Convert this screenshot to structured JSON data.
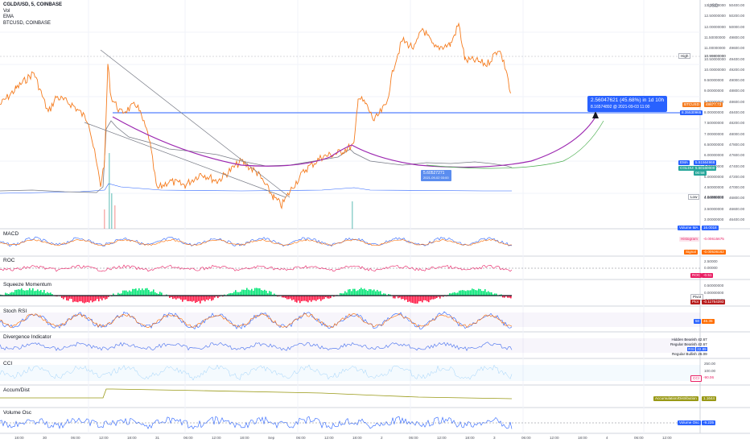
{
  "legend": {
    "symbol": "CGLD/USD, 5, COINBASE",
    "vol": "Vol",
    "ema": "EMA",
    "compare": "BTCUSD, COINBASE"
  },
  "currency": "USD",
  "panes": {
    "macd": "MACD",
    "roc": "ROC",
    "squeeze": "Squeeze Momentum",
    "stochrsi": "Stoch RSI",
    "divergence": "Divergence Indicator",
    "cci": "CCI",
    "accum": "Accum/Dist",
    "volosc": "Volume Osc"
  },
  "price_axis_left": [
    "13.00000000",
    "12.50000000",
    "12.00000000",
    "11.50000000",
    "11.00000000",
    "10.50000000",
    "10.00000000",
    "9.50000000",
    "9.00000000",
    "8.50000000",
    "8.00000000",
    "7.50000000",
    "7.00000000",
    "6.50000000",
    "6.00000000",
    "5.50000000",
    "5.00000000",
    "4.50000000",
    "4.00000000",
    "3.50000000",
    "3.00000000"
  ],
  "price_axis_right": [
    "50400.00",
    "50200.00",
    "50000.00",
    "49800.00",
    "49600.00",
    "49400.00",
    "49200.00",
    "49000.00",
    "48800.00",
    "48600.00",
    "48400.00",
    "48200.00",
    "48000.00",
    "47800.00",
    "47600.00",
    "47400.00",
    "47200.00",
    "47000.00",
    "46800.00",
    "46600.00",
    "46400.00"
  ],
  "tags": {
    "high_label": "High",
    "high_value": "10.99800000",
    "btcusd_label": "BTCUSD",
    "btcusd_value": "48677.73",
    "line_value": "8.35530965",
    "ema_label": "EMA",
    "ema_value": "5.51564968",
    "cgld_label": "CGLDUSD",
    "cgld_value": "5.50160000",
    "cgld_time": "00:58",
    "low_label": "Low",
    "low_value": "4.04990000",
    "volma_label": "Volume MA",
    "volma_value": "16.0018"
  },
  "callout": {
    "line1": "2.56047621 (45.68%) in 1d 10h",
    "line2": "8.16574892 @ 2021-09-03 11:00"
  },
  "callout_low": {
    "line1": "5.60527271",
    "line2": "2021-09-02 03:00"
  },
  "macd_tags": {
    "hist_label": "Histogram",
    "hist_value": "-0.00615675",
    "signal_label": "Signal",
    "signal_value": "-0.00536162"
  },
  "roc_tag": {
    "label": "ROC",
    "value": "-0.51"
  },
  "roc_axis": [
    "2.50000",
    "0.00000"
  ],
  "squeeze_axis": [
    "0.50000000",
    "0.00000000",
    "-0.50000000"
  ],
  "squeeze_tags": {
    "pivot_label": "Pivot",
    "pivot_value": "0.00000000",
    "plot_label": "Plot",
    "plot_value": "-0.11754393"
  },
  "stoch_tags": {
    "k": "50",
    "d": "46.35"
  },
  "div_tags": {
    "hidden_bearish": "Hidden Bearish",
    "hidden_bearish_val": "42.67",
    "regular_bearish": "Regular Bearish",
    "regular_bearish_val": "42.67",
    "rsi": "RSI",
    "rsi_val": "22.89",
    "regular_bullish": "Regular Bullish",
    "regular_bullish_val": "26.09"
  },
  "cci_axis": [
    "250.00",
    "100.00"
  ],
  "cci_tag": {
    "label": "CCI",
    "value": "-90.06"
  },
  "accum_tag": {
    "label": "Accumulation/Distribution",
    "value": "1.1644"
  },
  "volosc_tag": {
    "label": "Volume Osc",
    "value": "-9.235"
  },
  "time_axis": [
    "18:00",
    "30",
    "06:00",
    "12:00",
    "18:00",
    "31",
    "06:00",
    "12:00",
    "18:00",
    "Sep",
    "06:00",
    "12:00",
    "18:00",
    "2",
    "06:00",
    "12:00",
    "18:00",
    "3",
    "06:00",
    "12:00",
    "18:00",
    "4",
    "06:00",
    "12:00"
  ]
}
